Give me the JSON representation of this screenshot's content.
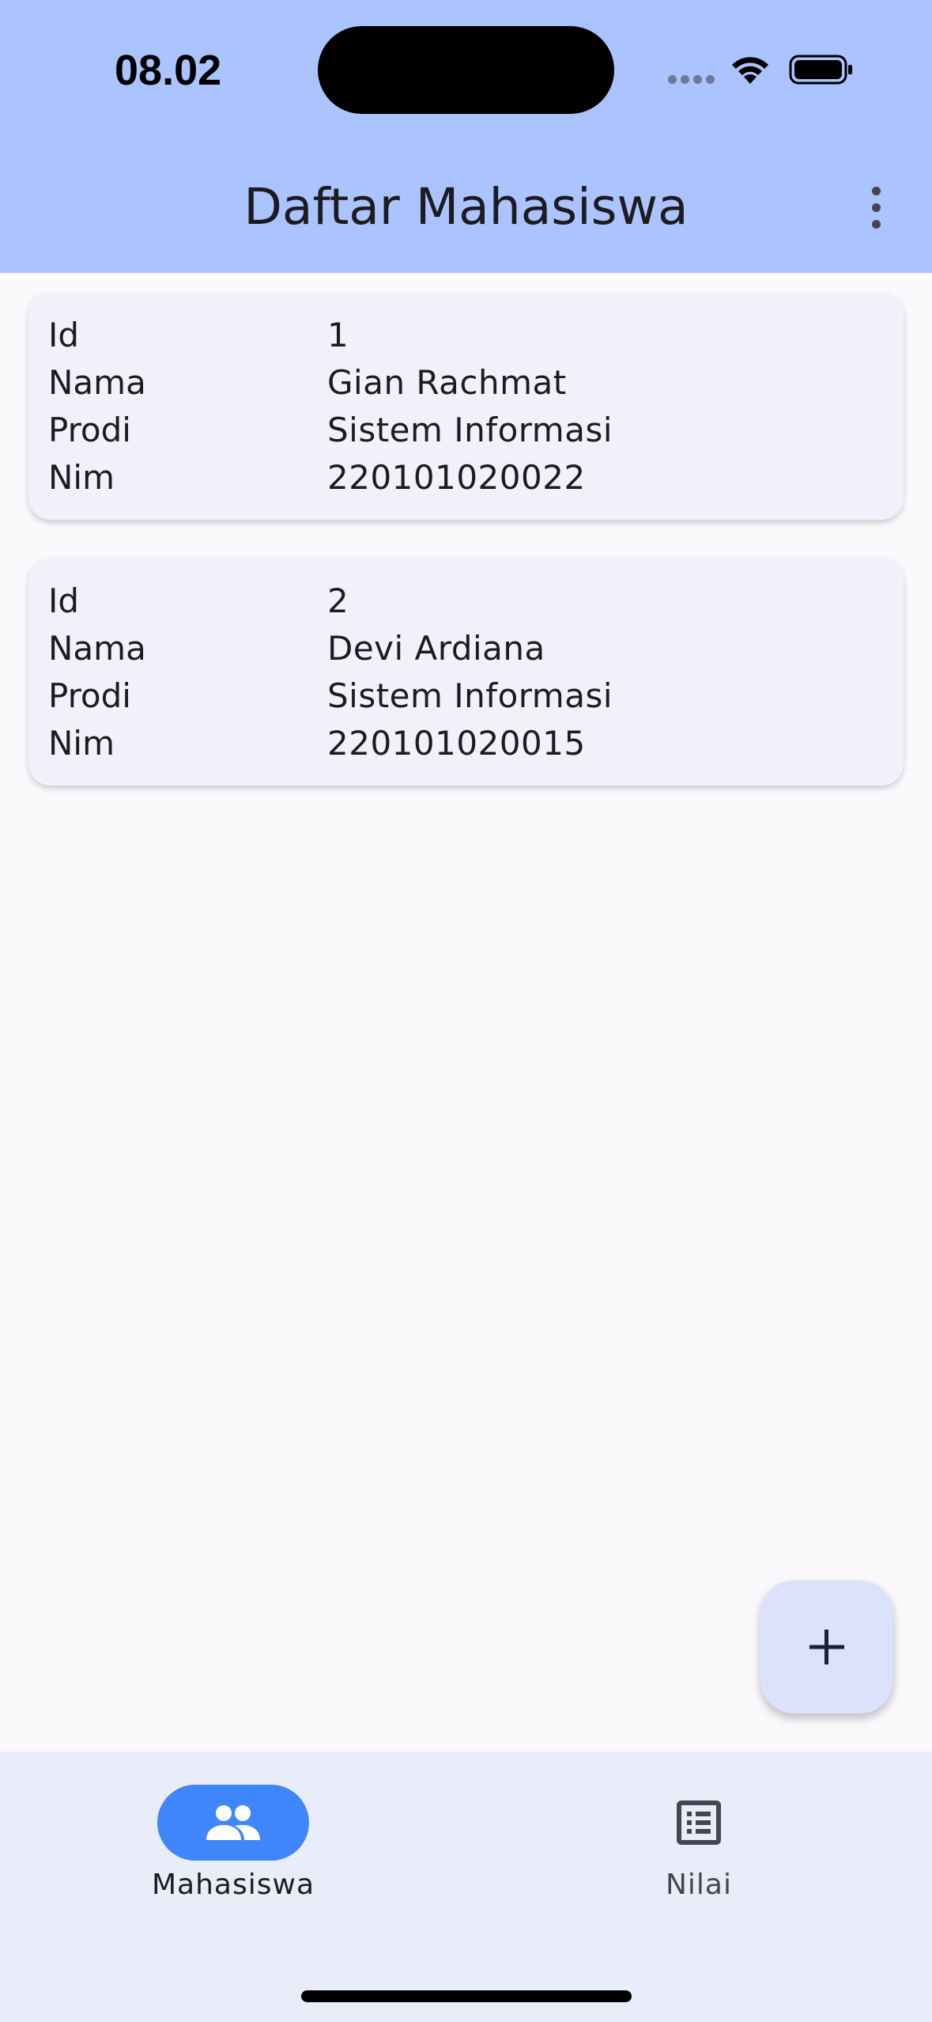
{
  "status_bar": {
    "time": "08.02"
  },
  "app_bar": {
    "title": "Daftar Mahasiswa",
    "menu_icon": "more-vert-icon"
  },
  "students": [
    {
      "fields": [
        {
          "label": "Id",
          "value": "1"
        },
        {
          "label": "Nama",
          "value": "Gian Rachmat"
        },
        {
          "label": "Prodi",
          "value": "Sistem Informasi"
        },
        {
          "label": "Nim",
          "value": "220101020022"
        }
      ]
    },
    {
      "fields": [
        {
          "label": "Id",
          "value": "2"
        },
        {
          "label": "Nama",
          "value": "Devi Ardiana"
        },
        {
          "label": "Prodi",
          "value": "Sistem Informasi"
        },
        {
          "label": "Nim",
          "value": "220101020015"
        }
      ]
    }
  ],
  "fab": {
    "icon": "add-icon"
  },
  "bottom_nav": {
    "items": [
      {
        "label": "Mahasiswa",
        "icon": "people-icon",
        "selected": true
      },
      {
        "label": "Nilai",
        "icon": "list-alt-icon",
        "selected": false
      }
    ]
  },
  "colors": {
    "app_bar": "#abc3fe",
    "card": "#f1f1f9",
    "nav_selected": "#3f86fb",
    "nav_background": "#e9edf9",
    "fab": "#dce2fb"
  }
}
